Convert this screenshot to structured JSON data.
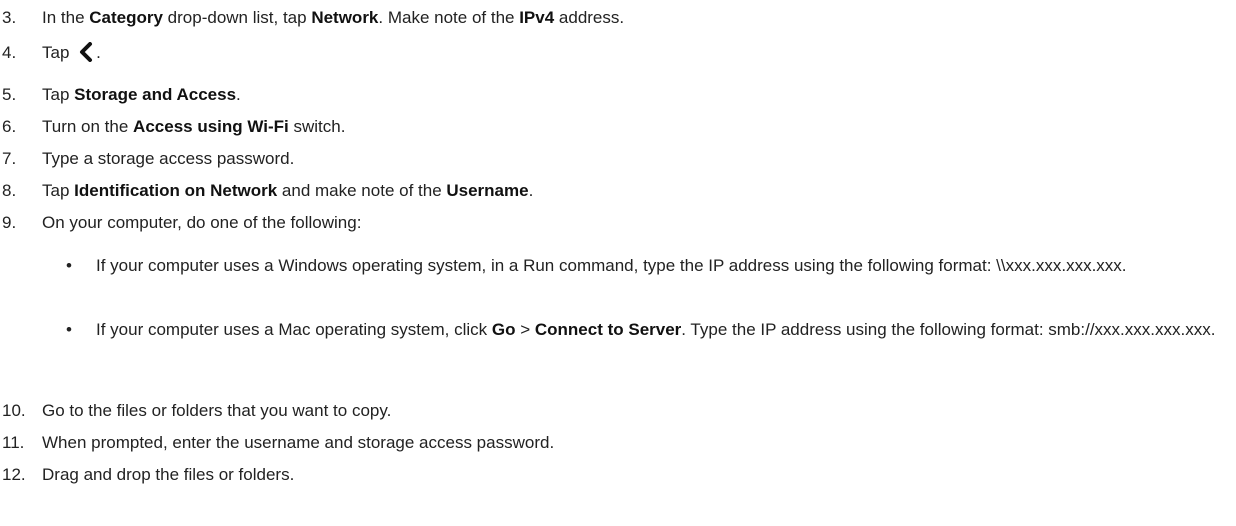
{
  "steps": [
    {
      "num": "3.",
      "t0": "In the ",
      "b0": "Category",
      "t1": " drop-down list, tap ",
      "b1": "Network",
      "t2": ". Make note of the ",
      "b2": "IPv4",
      "t3": " address."
    },
    {
      "num": "4.",
      "t0": "Tap ",
      "icon": "chevron-left-icon",
      "t1": "."
    },
    {
      "num": "5.",
      "t0": "Tap ",
      "b0": "Storage and Access",
      "t1": "."
    },
    {
      "num": "6.",
      "t0": "Turn on the ",
      "b0": "Access using Wi-Fi",
      "t1": " switch."
    },
    {
      "num": "7.",
      "t0": "Type a storage access password."
    },
    {
      "num": "8.",
      "t0": "Tap ",
      "b0": "Identification on Network",
      "t1": " and make note of the ",
      "b1": "Username",
      "t2": "."
    },
    {
      "num": "9.",
      "t0": "On your computer, do one of the following:"
    },
    {
      "num": "10.",
      "t0": "Go to the files or folders that you want to copy."
    },
    {
      "num": "11.",
      "t0": "When prompted, enter the username and storage access password."
    },
    {
      "num": "12.",
      "t0": "Drag and drop the files or folders."
    }
  ],
  "bullets": [
    {
      "mark": "•",
      "text": "If your computer uses a Windows operating system, in a Run command, type the IP address using the following format: \\\\xxx.xxx.xxx.xxx."
    },
    {
      "mark": "•",
      "t0": "If your computer uses a Mac operating system, click ",
      "b0": "Go",
      "t1": " > ",
      "b1": "Connect to Server",
      "t2": ". Type the IP address using the following format: smb://xxx.xxx.xxx.xxx."
    }
  ]
}
